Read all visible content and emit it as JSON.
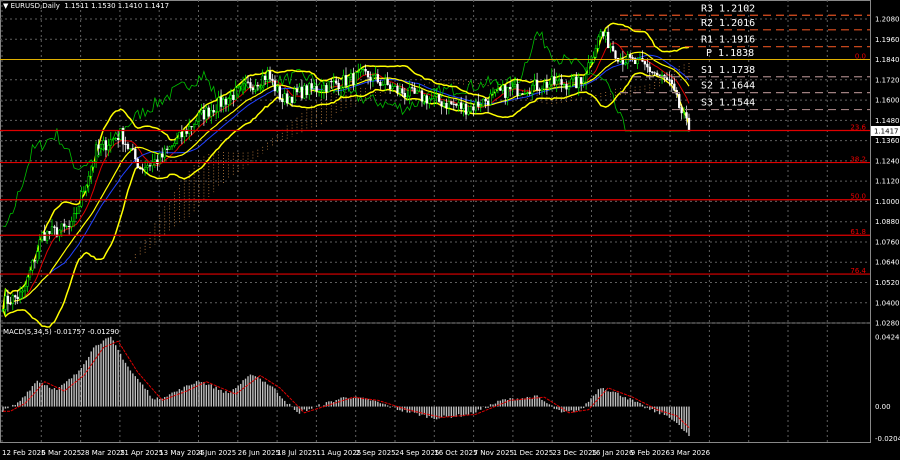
{
  "header": {
    "symbol": "EURUSD,Daily",
    "ohlc": "1.1511 1.1530 1.1410 1.1417"
  },
  "macd_header": {
    "label": "MACD(5,34,5)",
    "values": "-0.01757 -0.01290"
  },
  "colors": {
    "bull": "#00ff00",
    "bear": "#ffffff",
    "bands": "#ffff00",
    "fib": "#e00000",
    "pivot_r": "#e05020",
    "pivot_s": "#a08080",
    "pivot_p": "#e0b000",
    "macd_signal": "#e00000",
    "macd_hist": "#c0c0c0",
    "grid": "#606060"
  },
  "chart_data": {
    "type": "candlestick",
    "title": "EURUSD,Daily",
    "ylim": [
      1.022,
      1.214
    ],
    "y_ticks": [
      "1.2080",
      "1.1960",
      "1.1840",
      "1.1720",
      "1.1600",
      "1.1480",
      "1.1360",
      "1.1240",
      "1.1120",
      "1.1000",
      "1.0880",
      "1.0760",
      "1.0640",
      "1.0520",
      "1.0400",
      "1.0280"
    ],
    "last_price": "1.1417",
    "x_ticks": [
      "12 Feb 2025",
      "6 Mar 2025",
      "28 Mar 2025",
      "21 Apr 2025",
      "13 May 2025",
      "4 Jun 2025",
      "26 Jun 2025",
      "18 Jul 2025",
      "11 Aug 2025",
      "2 Sep 2025",
      "24 Sep 2025",
      "16 Oct 2025",
      "7 Nov 2025",
      "1 Dec 2025",
      "23 Dec 2025",
      "16 Jan 2026",
      "9 Feb 2026",
      "3 Mar 2026"
    ],
    "close_keypoints": [
      [
        0,
        1.04
      ],
      [
        8,
        1.045
      ],
      [
        16,
        1.08
      ],
      [
        28,
        1.085
      ],
      [
        38,
        1.13
      ],
      [
        48,
        1.14
      ],
      [
        56,
        1.12
      ],
      [
        64,
        1.125
      ],
      [
        80,
        1.15
      ],
      [
        96,
        1.165
      ],
      [
        108,
        1.175
      ],
      [
        114,
        1.16
      ],
      [
        122,
        1.165
      ],
      [
        136,
        1.17
      ],
      [
        148,
        1.175
      ],
      [
        162,
        1.165
      ],
      [
        176,
        1.16
      ],
      [
        190,
        1.155
      ],
      [
        204,
        1.165
      ],
      [
        224,
        1.17
      ],
      [
        236,
        1.17
      ],
      [
        244,
        1.2
      ],
      [
        252,
        1.185
      ],
      [
        262,
        1.18
      ],
      [
        272,
        1.17
      ],
      [
        280,
        1.142
      ]
    ],
    "pivots": [
      {
        "label": "R3",
        "value": "1.2102"
      },
      {
        "label": "R2",
        "value": "1.2016"
      },
      {
        "label": "R1",
        "value": "1.1916"
      },
      {
        "label": "P",
        "value": "1.1838"
      },
      {
        "label": "S1",
        "value": "1.1738"
      },
      {
        "label": "S2",
        "value": "1.1644"
      },
      {
        "label": "S3",
        "value": "1.1544"
      }
    ],
    "fib_levels": [
      {
        "label": "0.0",
        "price": 1.184
      },
      {
        "label": "23.6",
        "price": 1.142
      },
      {
        "label": "38.2",
        "price": 1.123
      },
      {
        "label": "50.0",
        "price": 1.101
      },
      {
        "label": "61.8",
        "price": 1.08
      },
      {
        "label": "76.4",
        "price": 1.057
      }
    ],
    "macd": {
      "ylim": [
        -0.02043,
        0.04249
      ],
      "y_ticks": [
        "0.04249",
        "0.00",
        "-0.02043"
      ],
      "hist_keypoints": [
        [
          0,
          -0.003
        ],
        [
          6,
          0.002
        ],
        [
          14,
          0.016
        ],
        [
          22,
          0.01
        ],
        [
          30,
          0.02
        ],
        [
          38,
          0.038
        ],
        [
          44,
          0.042
        ],
        [
          52,
          0.022
        ],
        [
          62,
          0.004
        ],
        [
          72,
          0.01
        ],
        [
          80,
          0.016
        ],
        [
          92,
          0.008
        ],
        [
          102,
          0.02
        ],
        [
          110,
          0.012
        ],
        [
          120,
          -0.004
        ],
        [
          132,
          0.002
        ],
        [
          140,
          0.006
        ],
        [
          150,
          0.004
        ],
        [
          162,
          -0.002
        ],
        [
          176,
          -0.007
        ],
        [
          190,
          -0.005
        ],
        [
          204,
          0.004
        ],
        [
          218,
          0.006
        ],
        [
          228,
          -0.004
        ],
        [
          236,
          -0.002
        ],
        [
          244,
          0.012
        ],
        [
          254,
          0.006
        ],
        [
          264,
          -0.002
        ],
        [
          272,
          -0.006
        ],
        [
          280,
          -0.018
        ]
      ]
    }
  }
}
